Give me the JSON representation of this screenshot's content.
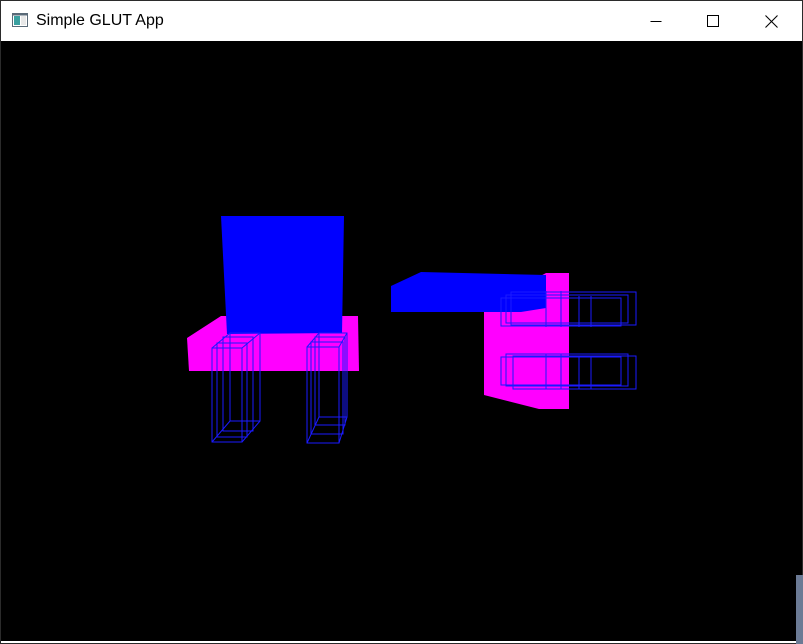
{
  "window": {
    "title": "Simple GLUT App",
    "icon": "glut-app-icon",
    "controls": {
      "minimize_icon": "minimize-icon",
      "maximize_icon": "maximize-icon",
      "close_icon": "close-icon"
    }
  },
  "scene": {
    "background": "#000000",
    "colors": {
      "solid_blue": "#0000ff",
      "magenta": "#ff00ff",
      "wire_blue": "#1a1aff"
    },
    "objects": [
      "chair-model-left",
      "chair-model-right"
    ]
  }
}
